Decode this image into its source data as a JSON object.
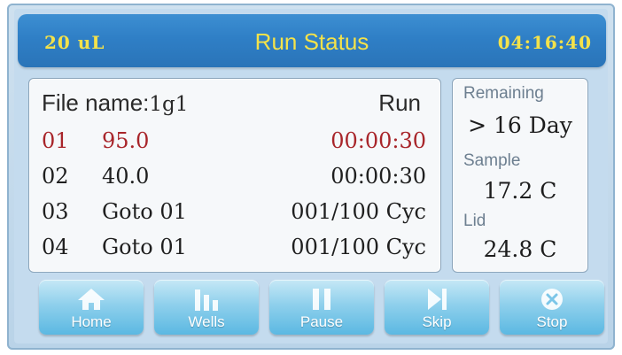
{
  "header": {
    "volume": "20 uL",
    "title": "Run Status",
    "clock": "04:16:40"
  },
  "file": {
    "label": "File name:",
    "name": "1g1",
    "state": "Run"
  },
  "steps": [
    {
      "num": "01",
      "cmd": "95.0",
      "time": "00:00:30",
      "active": true
    },
    {
      "num": "02",
      "cmd": "40.0",
      "time": "00:00:30",
      "active": false
    },
    {
      "num": "03",
      "cmd": "Goto 01",
      "time": "001/100 Cyc",
      "active": false
    },
    {
      "num": "04",
      "cmd": "Goto 01",
      "time": "001/100 Cyc",
      "active": false
    }
  ],
  "side": {
    "remaining_label": "Remaining",
    "remaining_value": "> 16 Day",
    "sample_label": "Sample",
    "sample_value": "17.2 C",
    "lid_label": "Lid",
    "lid_value": "24.8 C"
  },
  "buttons": {
    "home": "Home",
    "wells": "Wells",
    "pause": "Pause",
    "skip": "Skip",
    "stop": "Stop"
  },
  "colors": {
    "header_text": "#f4e24a",
    "active_step": "#a8252a",
    "header_bg": "#2f7fc6",
    "button_bg": "#8fd0ec"
  }
}
